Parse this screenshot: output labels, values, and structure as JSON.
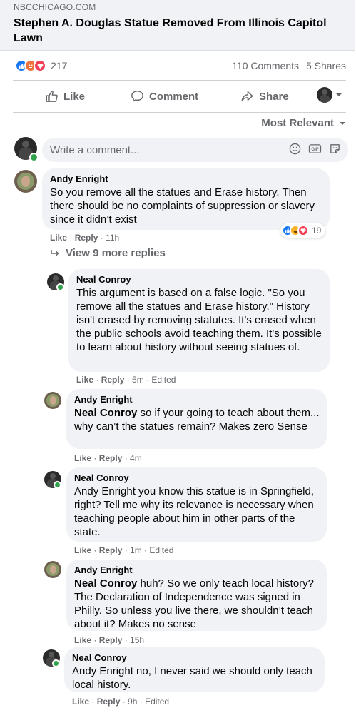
{
  "post": {
    "domain": "NBCCHICAGO.COM",
    "headline": "Stephen A. Douglas Statue Removed From Illinois Capitol Lawn",
    "reaction_count": "217",
    "comments": "110 Comments",
    "shares": "5 Shares"
  },
  "actions": {
    "like": "Like",
    "comment": "Comment",
    "share": "Share"
  },
  "sort_label": "Most Relevant",
  "write_comment": {
    "placeholder": "Write a comment..."
  },
  "comments": [
    {
      "author": "Andy Enright",
      "text": "So you remove all the statues and Erase history. Then there should be no complaints of suppression or slavery since it didn’t exist",
      "like": "Like",
      "reply": "Reply",
      "time": "11h",
      "reaction_count": "19"
    },
    {
      "author": "Neal Conroy",
      "text": "This argument is based on a false logic. \"So you remove all the statues and Erase history.\" History isn't erased by removing statutes. It's erased when the public schools avoid teaching them. It's possible to learn about history without seeing statues of.",
      "like": "Like",
      "reply": "Reply",
      "time": "5m",
      "edited": "Edited"
    },
    {
      "author": "Andy Enright",
      "mention": "Neal Conroy",
      "text": " so if your going to teach about them... why can’t the statues remain? Makes zero Sense",
      "like": "Like",
      "reply": "Reply",
      "time": "4m"
    },
    {
      "author": "Neal Conroy",
      "text": "Andy Enright you know this statue is in Springfield, right? Tell me why its relevance is necessary when teaching people about him in other parts of the state.",
      "like": "Like",
      "reply": "Reply",
      "time": "1m",
      "edited": "Edited"
    },
    {
      "author": "Andy Enright",
      "mention": "Neal Conroy",
      "text": " huh? So we only teach local history? The Declaration of Independence was signed in Philly. So unless you live there, we shouldn’t teach about it? Makes no sense",
      "like": "Like",
      "reply": "Reply",
      "time": "15h"
    },
    {
      "author": "Neal Conroy",
      "text": "Andy Enright no, I never said we should only teach local history.",
      "like": "Like",
      "reply": "Reply",
      "time": "9h",
      "edited": "Edited"
    }
  ],
  "view_more": "View 9 more replies",
  "colors": {
    "brand": "#1877f2",
    "bubble": "#f0f2f5",
    "muted": "#65676b",
    "online": "#31a24c"
  }
}
